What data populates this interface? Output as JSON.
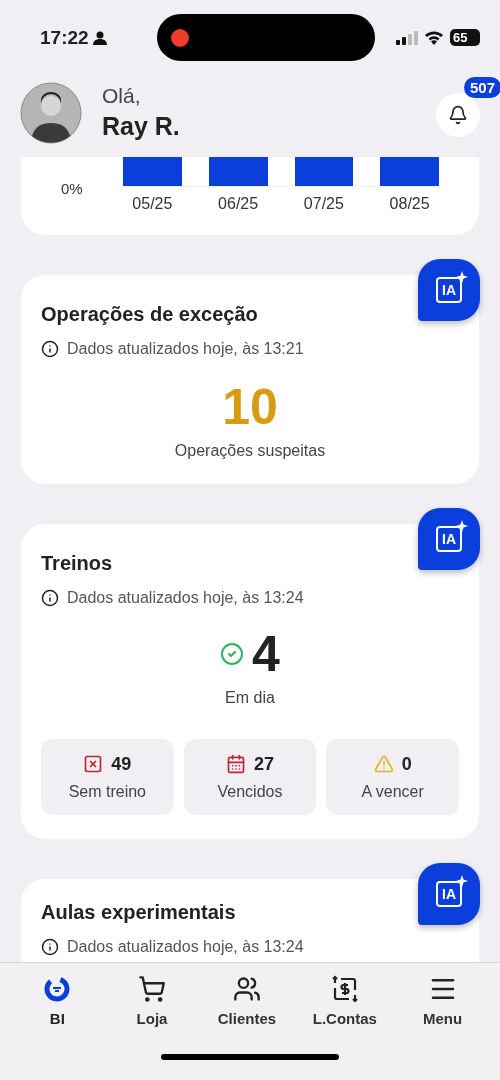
{
  "status_bar": {
    "time": "17:22",
    "battery": "65"
  },
  "header": {
    "greeting": "Olá,",
    "name": "Ray R.",
    "notification_count": "507"
  },
  "chart_card": {
    "axis_label": "0%",
    "categories": [
      "05/25",
      "06/25",
      "07/25",
      "08/25"
    ]
  },
  "cards": [
    {
      "kind": "metric",
      "title": "Operações de exceção",
      "updated": "Dados atualizados hoje, às 13:21",
      "ai_label": "IA",
      "value": "10",
      "value_label": "Operações suspeitas"
    },
    {
      "kind": "status",
      "title": "Treinos",
      "updated": "Dados atualizados hoje, às 13:24",
      "ai_label": "IA",
      "value": "4",
      "value_label": "Em dia",
      "stats": [
        {
          "kind": "missing",
          "value": "49",
          "label": "Sem treino",
          "color": "#c0272d"
        },
        {
          "kind": "overdue",
          "value": "27",
          "label": "Vencidos",
          "color": "#c0272d"
        },
        {
          "kind": "warning",
          "value": "0",
          "label": "A vencer",
          "color": "#e3b423"
        }
      ]
    },
    {
      "kind": "partial",
      "title": "Aulas experimentais",
      "updated": "Dados atualizados hoje, às 13:24",
      "ai_label": "IA"
    }
  ],
  "nav": [
    {
      "kind": "bi",
      "label": "BI",
      "selected": true
    },
    {
      "kind": "cart",
      "label": "Loja",
      "selected": false
    },
    {
      "kind": "people",
      "label": "Clientes",
      "selected": false
    },
    {
      "kind": "exchange",
      "label": "L.Contas",
      "selected": false
    },
    {
      "kind": "menu",
      "label": "Menu",
      "selected": false
    }
  ]
}
